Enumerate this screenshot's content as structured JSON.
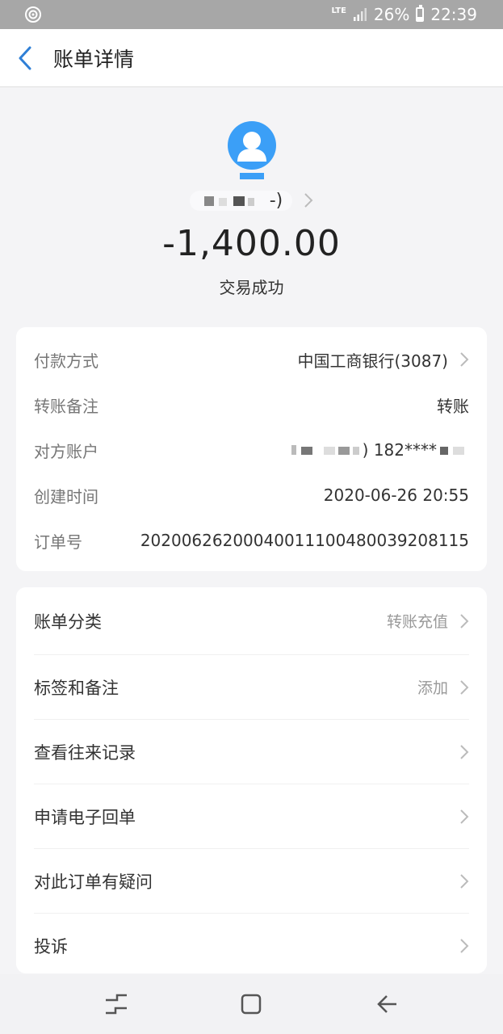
{
  "status_bar": {
    "network": "LTE",
    "battery": "26%",
    "time": "22:39"
  },
  "header": {
    "title": "账单详情"
  },
  "summary": {
    "payee_suffix": "-)",
    "amount": "-1,400.00",
    "status": "交易成功"
  },
  "details": [
    {
      "label": "付款方式",
      "value": "中国工商银行(3087)",
      "has_chevron": true
    },
    {
      "label": "转账备注",
      "value": "转账",
      "has_chevron": false
    },
    {
      "label": "对方账户",
      "value": ") 182****",
      "has_chevron": false
    },
    {
      "label": "创建时间",
      "value": "2020-06-26 20:55",
      "has_chevron": false
    },
    {
      "label": "订单号",
      "value": "20200626200040011100480039208115",
      "has_chevron": false
    }
  ],
  "actions": [
    {
      "label": "账单分类",
      "value": "转账充值"
    },
    {
      "label": "标签和备注",
      "value": "添加"
    },
    {
      "label": "查看往来记录",
      "value": ""
    },
    {
      "label": "申请电子回单",
      "value": ""
    },
    {
      "label": "对此订单有疑问",
      "value": ""
    },
    {
      "label": "投诉",
      "value": ""
    }
  ],
  "colors": {
    "accent": "#3b9ff7",
    "back_arrow": "#2f7fd6"
  }
}
